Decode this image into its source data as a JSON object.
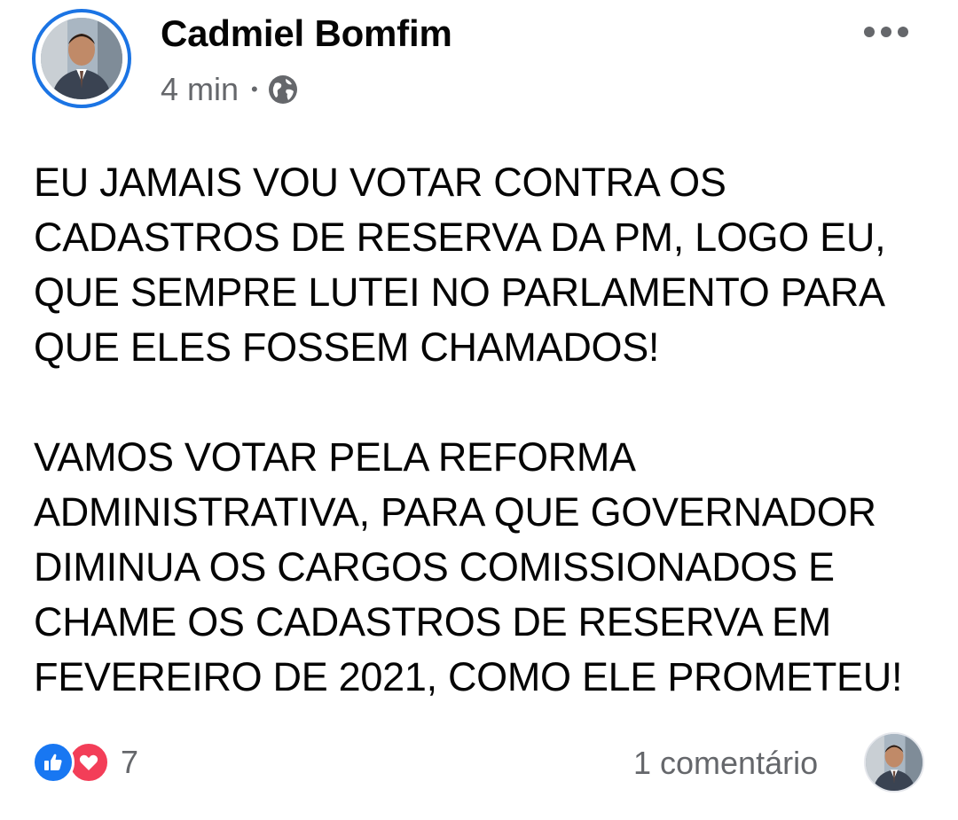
{
  "post": {
    "author": "Cadmiel Bomfim",
    "time": "4 min",
    "separator": "•",
    "privacy_icon": "globe-icon",
    "more_icon": "more-horizontal-icon",
    "text": "EU JAMAIS VOU VOTAR CONTRA OS\nCADASTROS DE RESERVA DA PM, LOGO EU,\nQUE SEMPRE LUTEI NO PARLAMENTO PARA\nQUE ELES FOSSEM CHAMADOS!\n\nVAMOS VOTAR PELA REFORMA\nADMINISTRATIVA, PARA QUE GOVERNADOR\nDIMINUA OS CARGOS COMISSIONADOS E\nCHAME OS CADASTROS DE RESERVA EM\nFEVEREIRO DE 2021, COMO ELE PROMETEU!"
  },
  "footer": {
    "reactions": [
      "like-icon",
      "love-icon"
    ],
    "reaction_count": "7",
    "comments_label": "1 comentário"
  },
  "colors": {
    "accent": "#1b74e4",
    "like": "#1877f2",
    "love": "#f33e58",
    "secondary_text": "#65676b"
  }
}
